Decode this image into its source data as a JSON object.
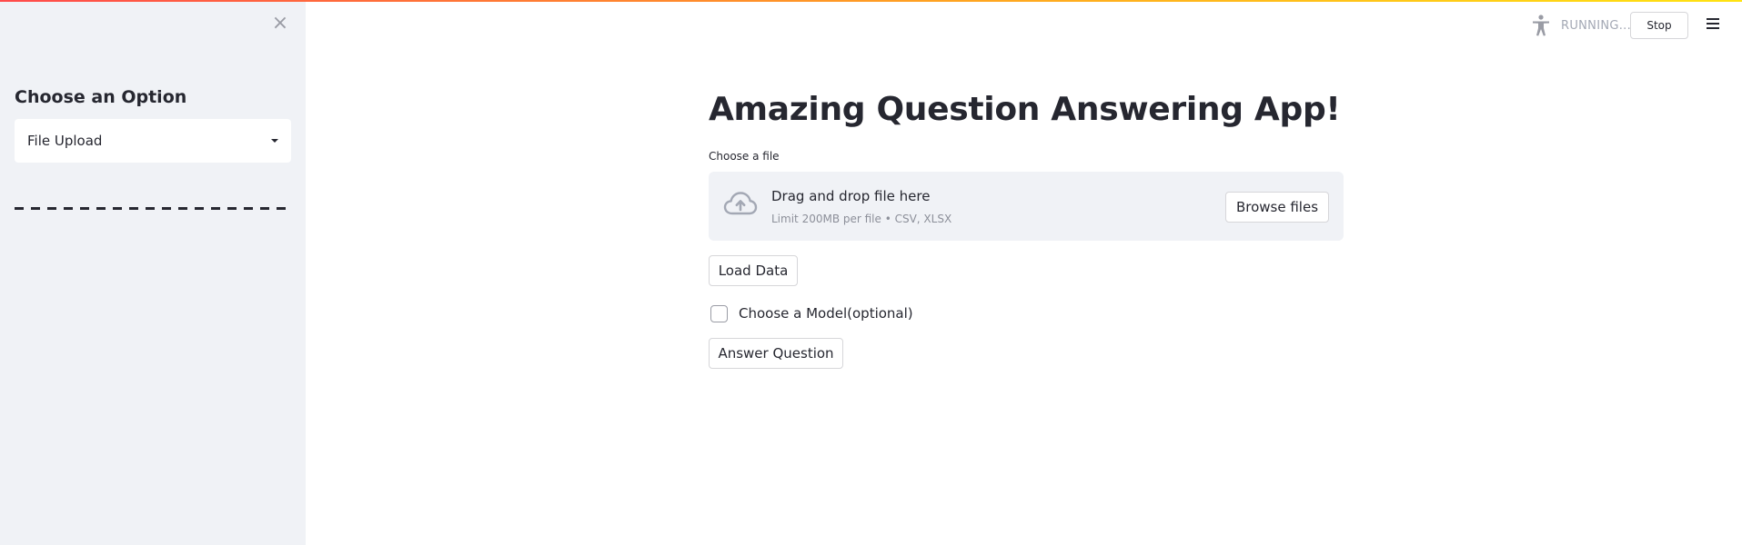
{
  "sidebar": {
    "close_glyph": "×",
    "title": "Choose an Option",
    "select": {
      "value": "File Upload",
      "caret_icon": "caret-down-icon"
    }
  },
  "header": {
    "accessibility_icon": "accessibility-icon",
    "status": "RUNNING...",
    "stop_label": "Stop",
    "menu_icon": "hamburger-menu-icon"
  },
  "main": {
    "title": "Amazing Question Answering App!",
    "uploader": {
      "label": "Choose a file",
      "icon": "cloud-upload-icon",
      "dropzone_title": "Drag and drop file here",
      "dropzone_subtitle": "Limit 200MB per file • CSV, XLSX",
      "browse_label": "Browse files"
    },
    "load_button": "Load Data",
    "checkbox": {
      "label": "Choose a Model(optional)",
      "checked": false
    },
    "answer_button": "Answer Question"
  },
  "colors": {
    "sidebar_bg": "#f0f2f6",
    "text": "#262730",
    "gradient_start": "#ff4b4b",
    "gradient_end": "#ffe312",
    "muted": "#a3a8b4"
  }
}
